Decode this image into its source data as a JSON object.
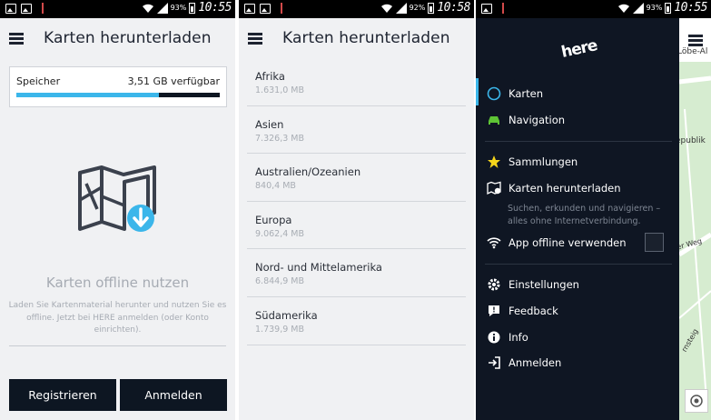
{
  "status": {
    "screen1": {
      "battery": "93%",
      "time": "10:55"
    },
    "screen2": {
      "battery": "92%",
      "time": "10:58"
    },
    "screen3": {
      "battery": "93%",
      "time": "10:55"
    }
  },
  "screen1": {
    "title": "Karten herunterladen",
    "storage": {
      "label": "Speicher",
      "free": "3,51 GB verfügbar",
      "used_fraction": 0.7
    },
    "offline_title": "Karten offline nutzen",
    "offline_desc": "Laden Sie Kartenmaterial herunter und nutzen Sie es offline. Jetzt bei HERE anmelden (oder Konto einrichten).",
    "buttons": {
      "register": "Registrieren",
      "login": "Anmelden"
    },
    "colors": {
      "accent": "#3bb6ea",
      "dark": "#0d1622"
    }
  },
  "screen2": {
    "title": "Karten herunterladen",
    "regions": [
      {
        "name": "Afrika",
        "size": "1.631,0 MB"
      },
      {
        "name": "Asien",
        "size": "7.326,3 MB"
      },
      {
        "name": "Australien/Ozeanien",
        "size": "840,4 MB"
      },
      {
        "name": "Europa",
        "size": "9.062,4 MB"
      },
      {
        "name": "Nord- und Mittelamerika",
        "size": "6.844,9 MB"
      },
      {
        "name": "Südamerika",
        "size": "1.739,9 MB"
      }
    ]
  },
  "screen3": {
    "logo": "here",
    "menu": {
      "karten": "Karten",
      "navigation": "Navigation",
      "sammlungen": "Sammlungen",
      "karten_herunterladen": "Karten herunterladen",
      "download_desc": "Suchen, erkunden und navigieren – alles ohne Internetverbindung.",
      "offline": "App offline verwenden",
      "einstellungen": "Einstellungen",
      "feedback": "Feedback",
      "info": "Info",
      "anmelden": "Anmelden"
    },
    "map_labels": {
      "top": "Löbe-Al",
      "mid": "epublik",
      "weg": "er Weg",
      "steig": "rnsteig"
    }
  }
}
